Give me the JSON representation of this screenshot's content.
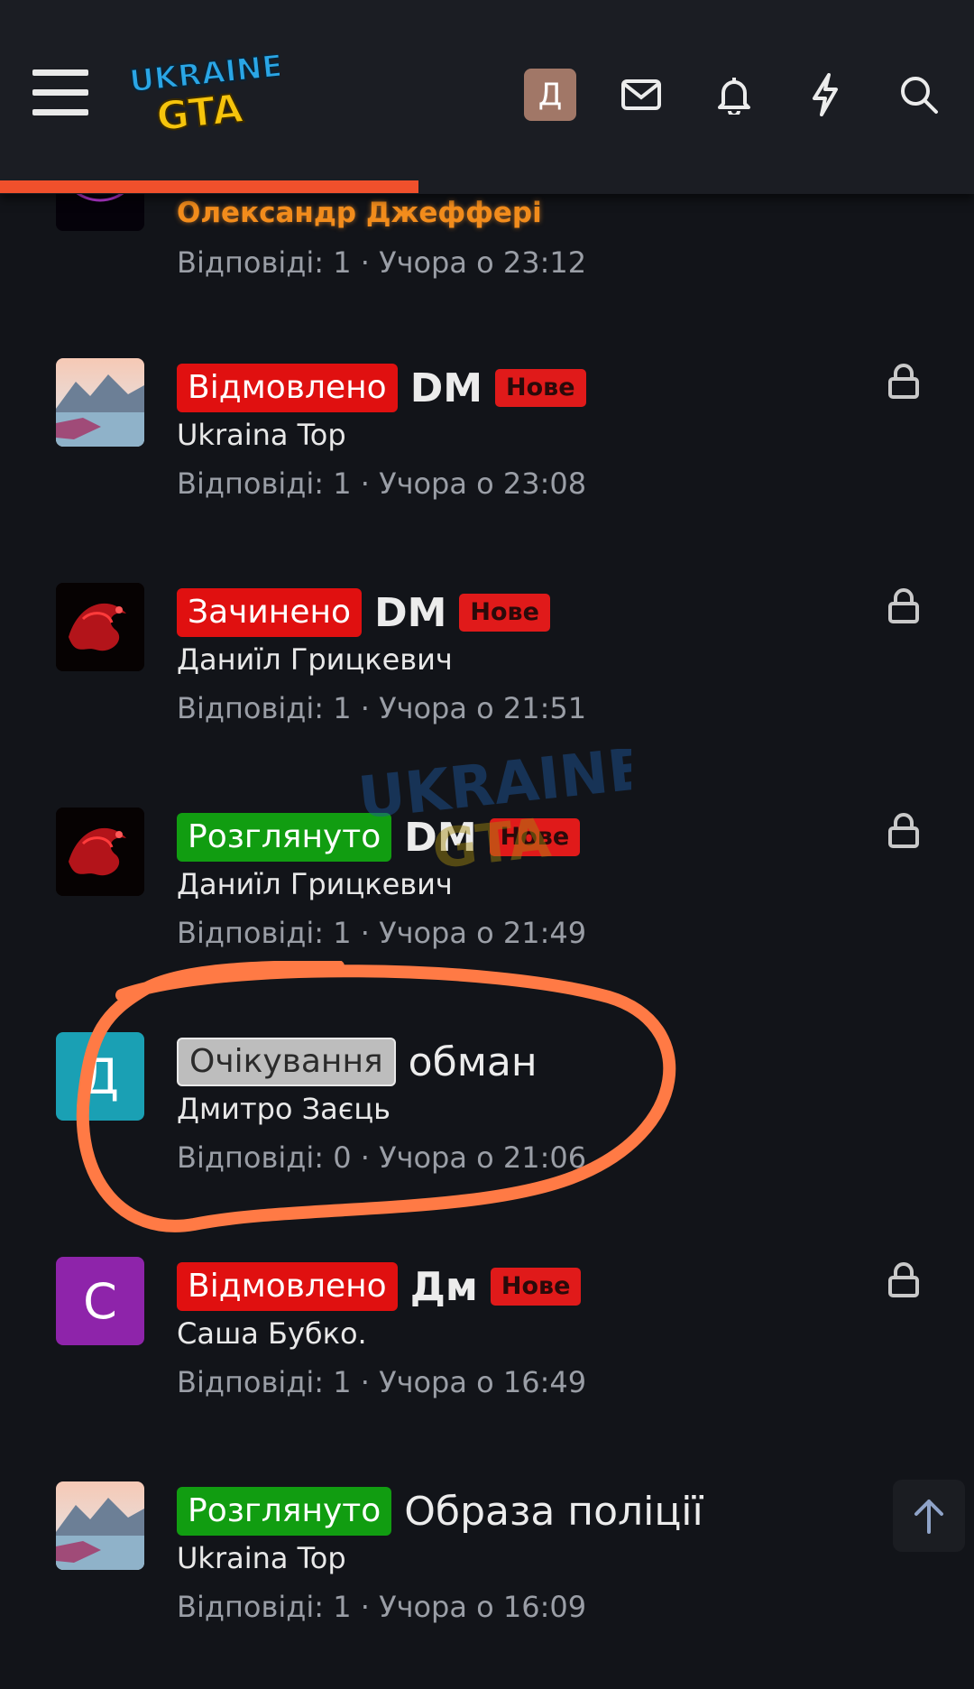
{
  "header": {
    "logo_text_top": "UKRAINE",
    "logo_text_bottom": "GTA",
    "avatar_letter": "Д",
    "icons": [
      "menu-icon",
      "envelope-icon",
      "bell-icon",
      "lightning-icon",
      "search-icon"
    ],
    "progress_fraction": 0.43
  },
  "threads": [
    {
      "status": "",
      "title": "",
      "new_badge": "",
      "author": "Олександр Джефферi",
      "meta": "Відповіді: 1 · Учора о 23:12",
      "locked": false,
      "avatar": "neon-orb"
    },
    {
      "status": "Відмовлено",
      "status_color": "#e01010",
      "title": "DM",
      "new_badge": "Нове",
      "author": "Ukraina Top",
      "meta": "Відповіді: 1 · Учора о 23:08",
      "locked": true,
      "avatar": "mountain-landscape"
    },
    {
      "status": "Зачинено",
      "status_color": "#e01010",
      "title": "DM",
      "new_badge": "Нове",
      "author": "Даниїл Грицкевич",
      "meta": "Відповіді: 1 · Учора о 21:51",
      "locked": true,
      "avatar": "red-dragon"
    },
    {
      "status": "Розглянуто",
      "status_color": "#119d11",
      "title": "DM",
      "new_badge": "Нове",
      "author": "Даниїл Грицкевич",
      "meta": "Відповіді: 1 · Учора о 21:49",
      "locked": true,
      "avatar": "red-dragon"
    },
    {
      "status": "Очікування",
      "status_color": "#bdbdbd",
      "title": "обман",
      "new_badge": "",
      "author": "Дмитро Заєць",
      "meta": "Відповіді: 0 · Учора о 21:06",
      "locked": false,
      "avatar_letter": "Д",
      "avatar_color": "#1aa0b4"
    },
    {
      "status": "Відмовлено",
      "status_color": "#e01010",
      "title": "Дм",
      "new_badge": "Нове",
      "author": "Саша Бубко.",
      "meta": "Відповіді: 1 · Учора о 16:49",
      "locked": true,
      "avatar_letter": "С",
      "avatar_color": "#8e24aa"
    },
    {
      "status": "Розглянуто",
      "status_color": "#119d11",
      "title": "Образа поліції",
      "new_badge": "",
      "author": "Ukraina Top",
      "meta": "Відповіді: 1 · Учора о 16:09",
      "locked": true,
      "avatar": "mountain-landscape"
    }
  ],
  "colors": {
    "background": "#121419",
    "header": "#1b1d23",
    "author_highlight": "#f28c1c",
    "annotation_circle": "#ff7a45"
  }
}
